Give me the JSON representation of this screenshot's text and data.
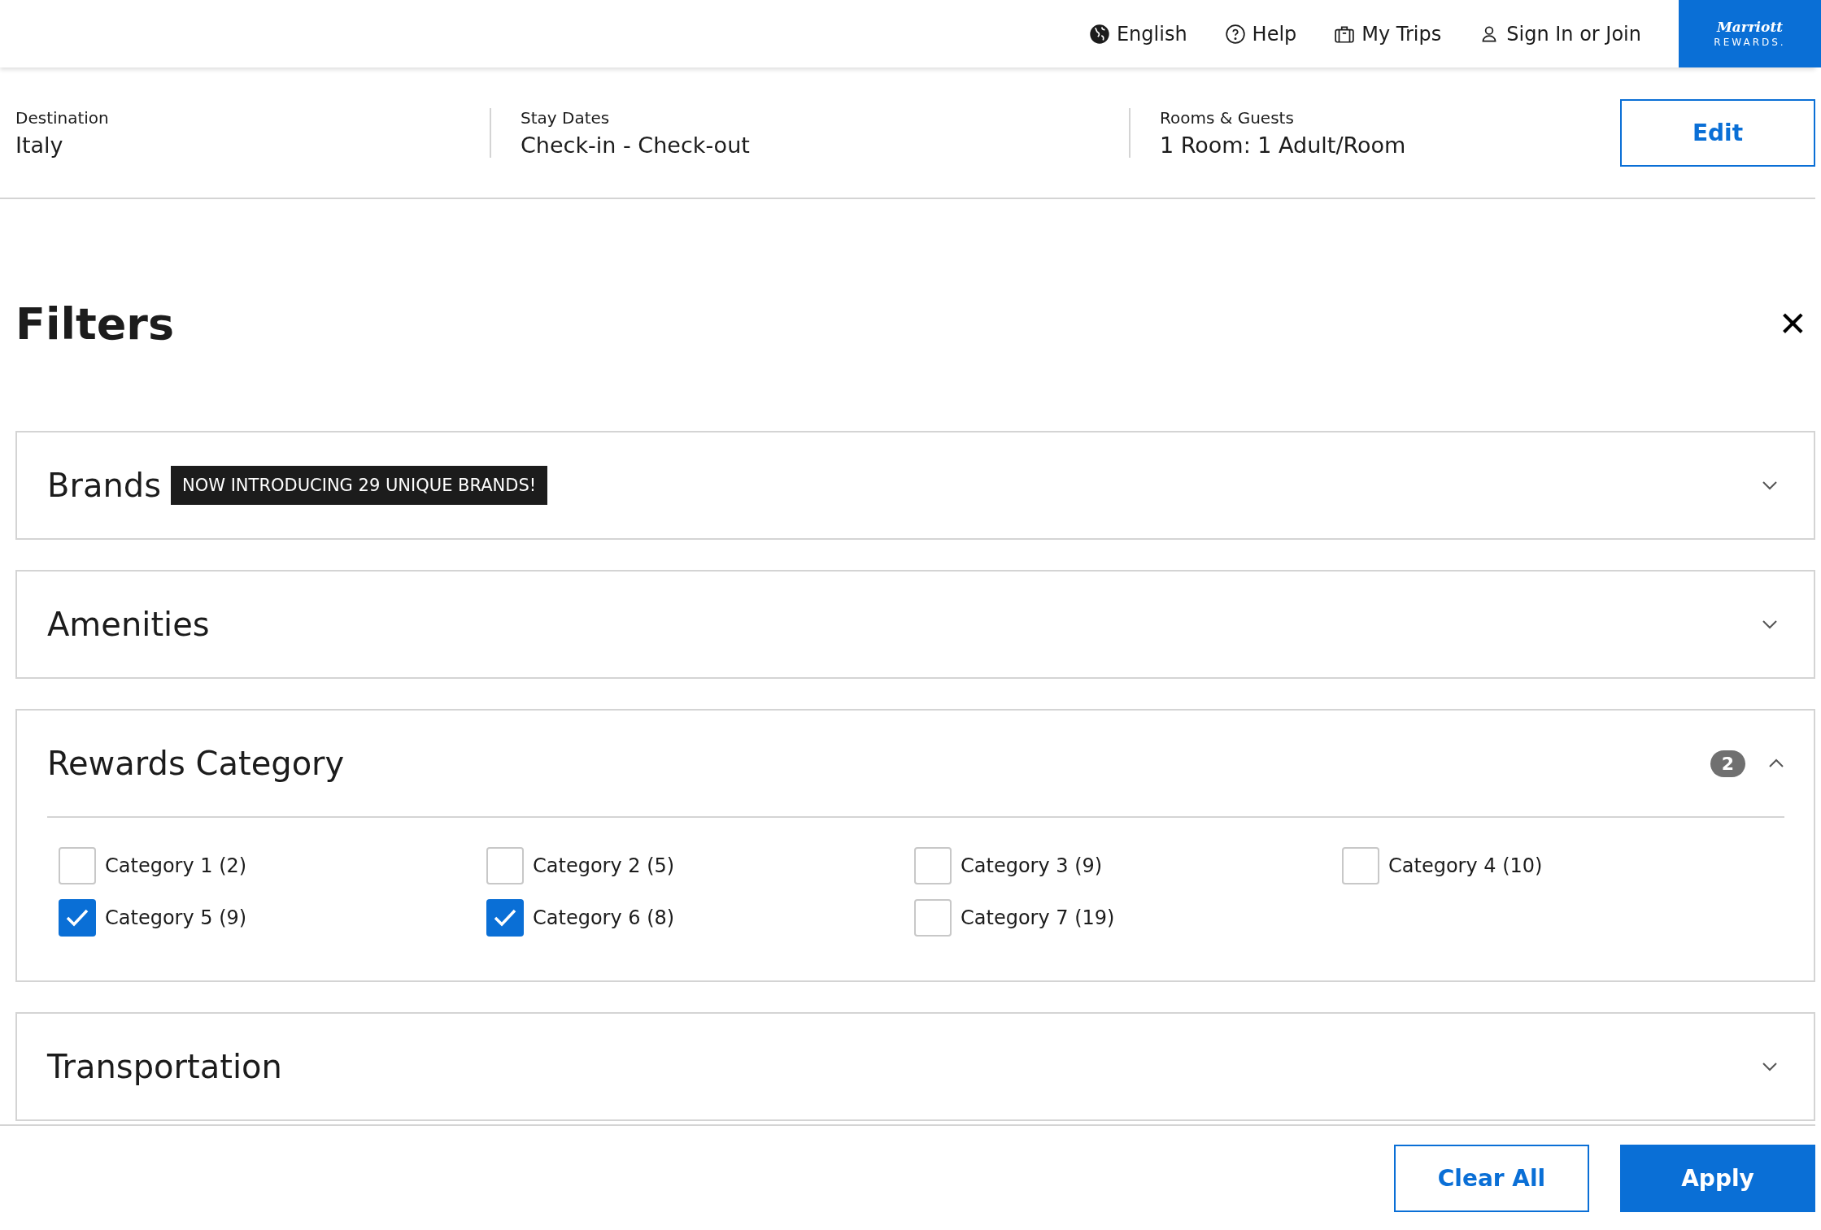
{
  "top_nav": {
    "items": [
      {
        "kind": "globe",
        "label": "English"
      },
      {
        "kind": "help",
        "label": "Help"
      },
      {
        "kind": "suitcase",
        "label": "My Trips"
      },
      {
        "kind": "person",
        "label": "Sign In or Join"
      }
    ],
    "logo": {
      "brand": "Marriott",
      "program": "REWARDS."
    }
  },
  "search_summary": {
    "fields": [
      {
        "label": "Destination",
        "value": "Italy"
      },
      {
        "label": "Stay Dates",
        "value": "Check-in - Check-out"
      },
      {
        "label": "Rooms & Guests",
        "value": "1 Room: 1 Adult/Room"
      }
    ],
    "edit_button": "Edit"
  },
  "filters": {
    "title": "Filters",
    "close": "✕",
    "sections": [
      {
        "title": "Brands",
        "tag": "NOW INTRODUCING 29 UNIQUE BRANDS!",
        "expanded": false
      },
      {
        "title": "Amenities",
        "expanded": false
      },
      {
        "title": "Rewards Category",
        "count": "2",
        "expanded": true,
        "options": [
          {
            "label": "Category 1 (2)",
            "checked": false
          },
          {
            "label": "Category 2 (5)",
            "checked": false
          },
          {
            "label": "Category 3 (9)",
            "checked": false
          },
          {
            "label": "Category 4 (10)",
            "checked": false
          },
          {
            "label": "Category 5 (9)",
            "checked": true
          },
          {
            "label": "Category 6 (8)",
            "checked": true
          },
          {
            "label": "Category 7 (19)",
            "checked": false
          }
        ]
      },
      {
        "title": "Transportation",
        "expanded": false
      }
    ]
  },
  "footer": {
    "buttons": [
      {
        "kind": "secondary",
        "label": "Clear All"
      },
      {
        "kind": "primary",
        "label": "Apply"
      }
    ]
  }
}
